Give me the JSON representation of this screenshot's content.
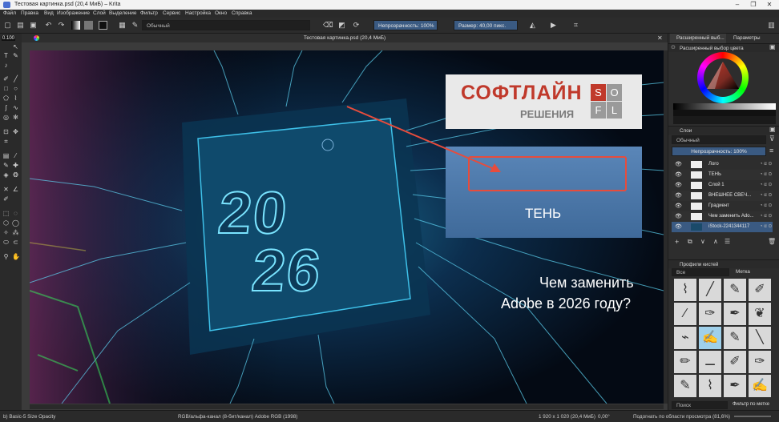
{
  "window": {
    "title": "Тестовая картинка.psd (20,4 МиБ) – Krita",
    "controls": [
      "–",
      "❐",
      "✕"
    ]
  },
  "menu": [
    "Файл",
    "Правка",
    "Вид",
    "Изображение",
    "Слой",
    "Выделение",
    "Фильтр",
    "Сервис",
    "Настройка",
    "Окно",
    "Справка"
  ],
  "toolbar": {
    "blend_mode": "Обычный",
    "opacity_label": "Непрозрачность: 100%",
    "size_label": "Размер: 40,00 пикс."
  },
  "toolbox": {
    "size_tooltip": "0.100"
  },
  "document": {
    "tab_title": "Тестовая картинка.psd (20,4 МиБ)",
    "artwork": {
      "logo_main": "СОФТЛАЙН",
      "logo_sub": "РЕШЕНИЯ",
      "logo_grid": [
        "S",
        "O",
        "F",
        "L"
      ],
      "shadow_label": "ТЕНЬ",
      "year_top": "20",
      "year_bottom": "26",
      "headline_line1": "Чем заменить",
      "headline_line2": "Adobe в 2026 году?"
    }
  },
  "panels": {
    "tabs": [
      "Расширенный выб...",
      "Параметры инстр..."
    ],
    "color_header": "Расширенный выбор цвета",
    "layers_header": "Слои",
    "layers_blend": "Обычный",
    "layers_opacity": "Непрозрачность: 100%",
    "layers": [
      {
        "name": "Лого",
        "selected": false
      },
      {
        "name": "ТЕНЬ",
        "selected": false
      },
      {
        "name": "Слой 1",
        "selected": false
      },
      {
        "name": "ВНЕШНЕЕ СВЕЧ...",
        "selected": false
      },
      {
        "name": "Градиент",
        "selected": false
      },
      {
        "name": "Чем заменить Ado...",
        "selected": false
      },
      {
        "name": "iStock-2241344117",
        "selected": true
      }
    ],
    "brushes_header": "Профили кистей",
    "brushes_filter": "Все",
    "brushes_tag": "Метка",
    "brushes_search": "Поиск",
    "brushes_filter_by_tag": "Фильтр по метке"
  },
  "status": {
    "brush": "b) Basic-5 Size Opacity",
    "color_model": "RGB/альфа-канал (8-бит/канал)  Adobe RGB (1998)",
    "dimensions": "1 920 х 1 020 (20,4 МиБ)",
    "rotation": "0,00°",
    "zoom": "Подогнать по области просмотра (81,6%)"
  },
  "colors": {
    "accent": "#3a5a82",
    "logo_red": "#c0392b",
    "arrow": "#e74c3c"
  }
}
